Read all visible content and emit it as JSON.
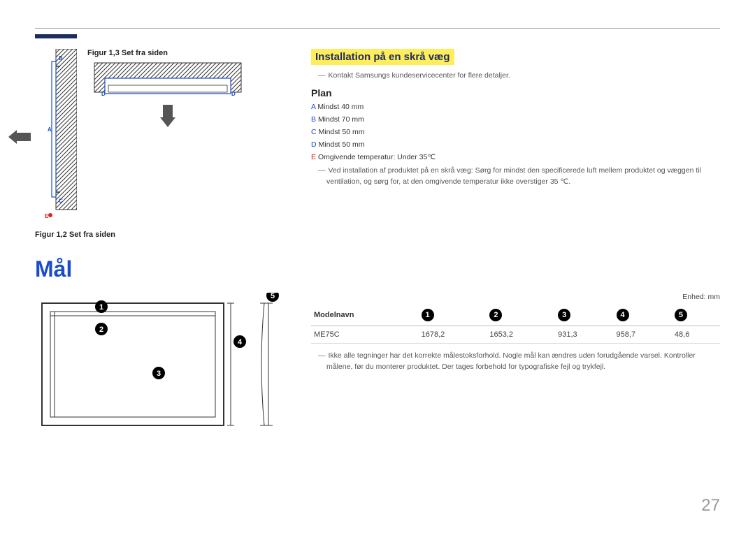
{
  "captions": {
    "fig13": "Figur 1,3 Set fra siden",
    "fig12": "Figur 1,2 Set fra siden"
  },
  "install": {
    "title": "Installation på en skrå væg",
    "note": "Kontakt Samsungs kundeservicecenter for flere detaljer."
  },
  "plan": {
    "title": "Plan",
    "a_label": "A",
    "a_text": "Mindst 40 mm",
    "b_label": "B",
    "b_text": "Mindst 70 mm",
    "c_label": "C",
    "c_text": "Mindst 50 mm",
    "d_label": "D",
    "d_text": "Mindst 50 mm",
    "e_label": "E",
    "e_text": "Omgivende temperatur: Under 35℃",
    "install_note": "Ved installation af produktet på en skrå væg: Sørg for mindst den specificerede luft mellem produktet og væggen til ventilation, og sørg for, at den omgivende temperatur ikke overstiger 35 ℃."
  },
  "mal": {
    "heading": "Mål",
    "unit": "Enhed: mm",
    "table": {
      "model_header": "Modelnavn",
      "cols": [
        "1",
        "2",
        "3",
        "4",
        "5"
      ],
      "row": {
        "model": "ME75C",
        "v1": "1678,2",
        "v2": "1653,2",
        "v3": "931,3",
        "v4": "958,7",
        "v5": "48,6"
      }
    },
    "note": "Ikke alle tegninger har det korrekte målestoksforhold. Nogle mål kan ændres uden forudgående varsel. Kontroller målene, før du monterer produktet. Der tages forbehold for typografiske fejl og trykfejl."
  },
  "diagram_labels": {
    "A": "A",
    "B": "B",
    "C": "C",
    "D": "D",
    "E": "E"
  },
  "page": "27"
}
